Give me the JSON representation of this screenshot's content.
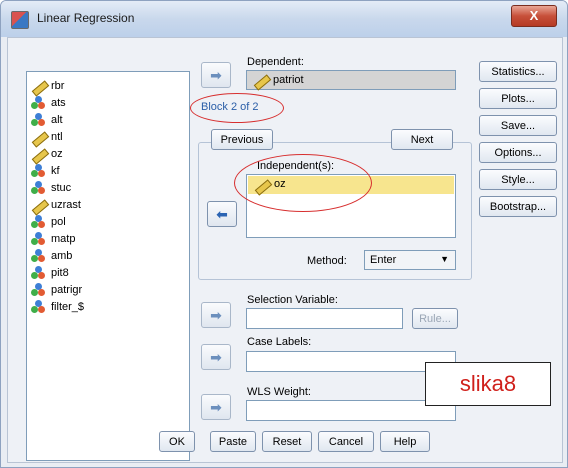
{
  "window": {
    "title": "Linear Regression",
    "close_glyph": "X"
  },
  "variables": [
    {
      "name": "rbr",
      "icon": "ruler-icon"
    },
    {
      "name": "ats",
      "icon": "nominal-icon"
    },
    {
      "name": "alt",
      "icon": "nominal-icon"
    },
    {
      "name": "ntl",
      "icon": "ruler-icon"
    },
    {
      "name": "oz",
      "icon": "ruler-icon"
    },
    {
      "name": "kf",
      "icon": "nominal-icon"
    },
    {
      "name": "stuc",
      "icon": "nominal-icon"
    },
    {
      "name": "uzrast",
      "icon": "ruler-icon"
    },
    {
      "name": "pol",
      "icon": "nominal-icon"
    },
    {
      "name": "matp",
      "icon": "nominal-icon"
    },
    {
      "name": "amb",
      "icon": "nominal-icon"
    },
    {
      "name": "pit8",
      "icon": "nominal-icon"
    },
    {
      "name": "patrigr",
      "icon": "nominal-icon"
    },
    {
      "name": "filter_$",
      "icon": "nominal-icon"
    }
  ],
  "dependent": {
    "label": "Dependent:",
    "value": "patriot"
  },
  "block": {
    "label": "Block 2 of 2",
    "previous": "Previous",
    "next": "Next"
  },
  "independent": {
    "label": "Independent(s):",
    "values": [
      "oz"
    ]
  },
  "method": {
    "label": "Method:",
    "value": "Enter"
  },
  "selection": {
    "label": "Selection Variable:",
    "rule": "Rule..."
  },
  "case_labels": {
    "label": "Case Labels:"
  },
  "wls": {
    "label": "WLS Weight:"
  },
  "side_buttons": [
    "Statistics...",
    "Plots...",
    "Save...",
    "Options...",
    "Style...",
    "Bootstrap..."
  ],
  "bottom_buttons": [
    "OK",
    "Paste",
    "Reset",
    "Cancel",
    "Help"
  ],
  "annotation": "slika8",
  "colors": {
    "highlight": "#f7e58e",
    "annotation_red": "#d0201b",
    "selected_field": "#d4d4d4"
  }
}
